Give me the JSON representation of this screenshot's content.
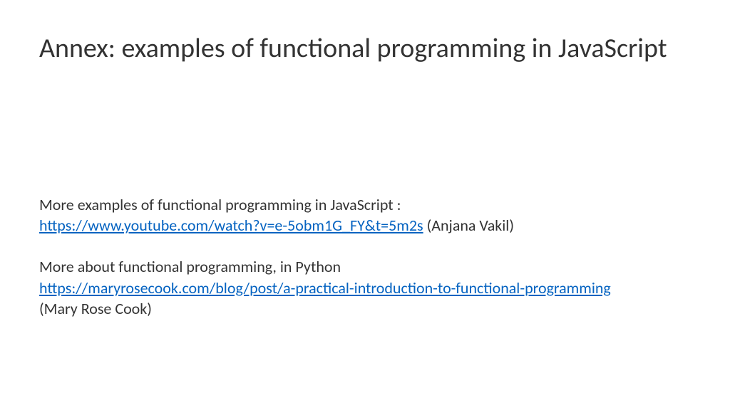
{
  "title": "Annex: examples of functional programming in JavaScript",
  "content": {
    "line1": "More examples of functional programming in JavaScript :",
    "link1": "https://www.youtube.com/watch?v=e-5obm1G_FY&t=5m2s",
    "author1": "  (Anjana Vakil)",
    "line2": "More about functional programming, in Python",
    "link2": "https://maryrosecook.com/blog/post/a-practical-introduction-to-functional-programming",
    "author2": "(Mary Rose Cook)"
  }
}
